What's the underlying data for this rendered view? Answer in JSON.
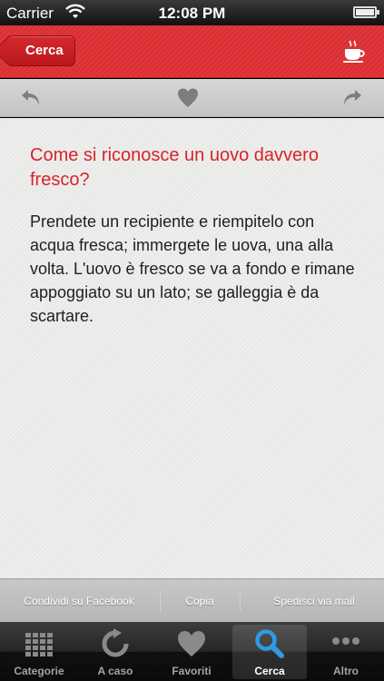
{
  "status_bar": {
    "carrier": "Carrier",
    "time": "12:08 PM"
  },
  "header": {
    "back_label": "Cerca",
    "right_icon": "coffee-cup-icon"
  },
  "toolbar": {
    "icons": [
      "undo-arrow-icon",
      "heart-icon",
      "redo-arrow-icon"
    ]
  },
  "content": {
    "question": "Come si riconosce un uovo davvero fresco?",
    "answer": "Prendete un recipiente e riempitelo con acqua fresca; immergete le uova, una alla volta. L'uovo è fresco se va a fondo e rimane appoggiato su un lato; se galleggia è da scartare."
  },
  "share_bar": {
    "facebook": "Condividi su Facebook",
    "copy": "Copia",
    "mail": "Spedisci via mail"
  },
  "tab_bar": {
    "active": "Cerca",
    "tabs": [
      {
        "label": "Categorie",
        "icon": "grid-icon"
      },
      {
        "label": "A caso",
        "icon": "refresh-icon"
      },
      {
        "label": "Favoriti",
        "icon": "heart-icon"
      },
      {
        "label": "Cerca",
        "icon": "search-icon"
      },
      {
        "label": "Altro",
        "icon": "more-icon"
      }
    ]
  },
  "colors": {
    "header_red": "#e0383c",
    "question_red": "#d8232a",
    "text_dark": "#1f1f1f"
  }
}
